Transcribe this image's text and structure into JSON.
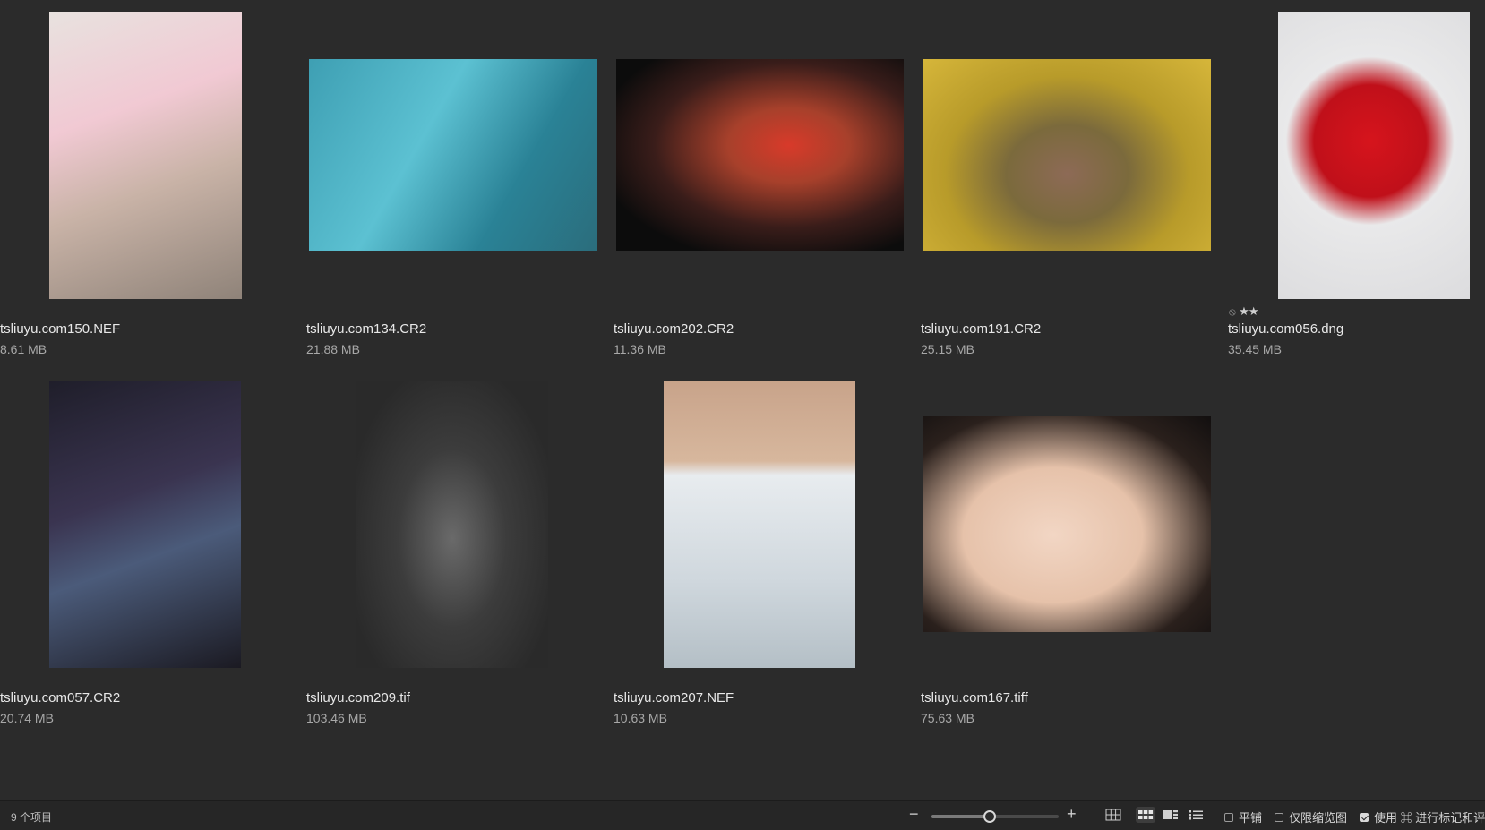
{
  "items": [
    {
      "name": "tsliuyu.com150.NEF",
      "size": "8.61 MB",
      "bg": "linear-gradient(160deg,#e8e2df 0%,#f1c9d3 35%,#c9b3a7 60%,#8f8379 100%)"
    },
    {
      "name": "tsliuyu.com134.CR2",
      "size": "21.88 MB",
      "bg": "linear-gradient(120deg,#3e9fb3 0%,#5cc1d2 40%,#2a8296 70%,#2b6d7c 100%)"
    },
    {
      "name": "tsliuyu.com202.CR2",
      "size": "11.36 MB",
      "bg": "radial-gradient(ellipse at 60% 45%,#d83a2a 0%,#a7402b 25%,#3a1d1a 55%,#0c0c0c 80%)"
    },
    {
      "name": "tsliuyu.com191.CR2",
      "size": "25.15 MB",
      "bg": "radial-gradient(ellipse at 50% 60%,#8d6a56 0%,#7b6a3c 30%,#b89b2a 60%,#d6b63a 100%)"
    },
    {
      "name": "tsliuyu.com056.dng",
      "size": "35.45 MB",
      "rating": "★★",
      "bg": "radial-gradient(circle at 48% 45%,#d6141c 0%,#c0101a 30%,#e9e9ea 45%,#dcdcde 100%)"
    },
    {
      "name": "tsliuyu.com057.CR2",
      "size": "20.74 MB",
      "bg": "linear-gradient(160deg,#1f1e2a 0%,#3a3450 40%,#4b5b7a 60%,#1b1a22 100%)"
    },
    {
      "name": "tsliuyu.com209.tif",
      "size": "103.46 MB",
      "bg": "radial-gradient(ellipse at 50% 55%,#6a6a6a 0%,#3c3c3c 40%,#2a2a2a 80%)"
    },
    {
      "name": "tsliuyu.com207.NEF",
      "size": "10.63 MB",
      "bg": "linear-gradient(180deg,#c8a38a 0%,#d7b79d 28%,#e8ecef 33%,#cfd7dd 70%,#b4bfc6 100%)"
    },
    {
      "name": "tsliuyu.com167.tiff",
      "size": "75.63 MB",
      "bg": "radial-gradient(ellipse at 45% 55%,#f2d6c4 0%,#e6c2aa 40%,#2a201c 75%,#120f0f 100%)"
    }
  ],
  "status": {
    "count": "9 个项目",
    "zoom_level": 0.45,
    "tile_label": "平铺",
    "thumbs_only_label": "仅限缩览图",
    "use_label": "使用 ⌘ 进行标记和评"
  },
  "icons": {
    "zoom_out": "−",
    "zoom_in": "+",
    "no_entry": "⦸",
    "views": [
      "view-grid-large-icon",
      "view-grid-icon",
      "view-filmstrip-icon",
      "view-list-icon"
    ]
  },
  "colors": {
    "background": "#2b2b2b",
    "statusbar": "#262626",
    "text": "#e6e6e6",
    "subtext": "#a8a8a8"
  }
}
